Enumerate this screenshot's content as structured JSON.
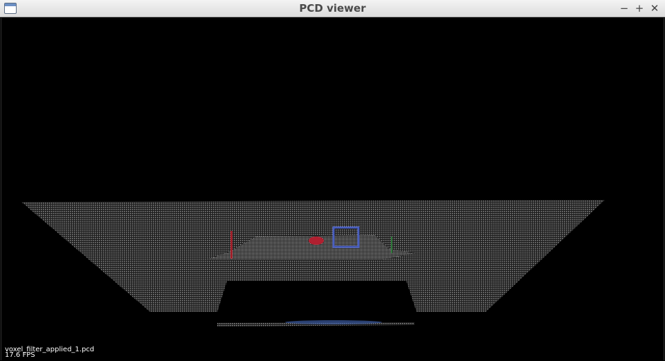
{
  "window": {
    "title": "PCD viewer",
    "minimize_glyph": "−",
    "maximize_glyph": "+",
    "close_glyph": "✕"
  },
  "viewer": {
    "file_name": "voxel_filter_applied_1.pcd",
    "fps": "17.6 FPS",
    "background_color": "#000000",
    "cloud_color": "#8a8a8a"
  }
}
